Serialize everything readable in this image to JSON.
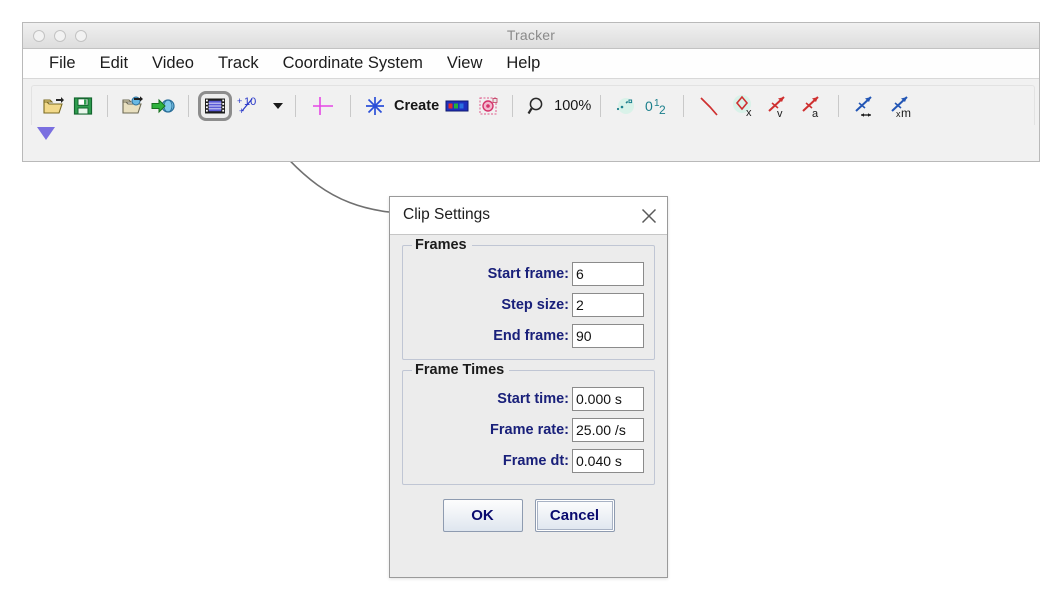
{
  "window": {
    "title": "Tracker",
    "traffic_lights": [
      "close-button",
      "minimize-button",
      "maximize-button"
    ]
  },
  "menubar": {
    "items": [
      {
        "label": "File",
        "name": "menu-file"
      },
      {
        "label": "Edit",
        "name": "menu-edit"
      },
      {
        "label": "Video",
        "name": "menu-video"
      },
      {
        "label": "Track",
        "name": "menu-track"
      },
      {
        "label": "Coordinate System",
        "name": "menu-coordinate-system"
      },
      {
        "label": "View",
        "name": "menu-view"
      },
      {
        "label": "Help",
        "name": "menu-help"
      }
    ]
  },
  "toolbar": {
    "create_label": "Create",
    "zoom_label": "100%",
    "buttons": [
      {
        "name": "open-file-button",
        "icon": "open-folder-icon"
      },
      {
        "name": "save-file-button",
        "icon": "floppy-save-icon"
      },
      {
        "name": "open-library-button",
        "icon": "open-folder-arrow-icon"
      },
      {
        "name": "library-browser-button",
        "icon": "green-arrow-globe-icon"
      },
      {
        "name": "clip-settings-button",
        "icon": "film-strip-icon",
        "selected": true
      },
      {
        "name": "frame-step-button",
        "icon": "plus-ten-icon"
      },
      {
        "name": "axes-button",
        "icon": "magenta-axes-icon"
      },
      {
        "name": "create-track-button",
        "icon": "blue-star-icon"
      },
      {
        "name": "track-control-button",
        "icon": "rgb-strip-icon"
      },
      {
        "name": "autotracker-button",
        "icon": "pink-target-icon"
      },
      {
        "name": "zoom-button",
        "icon": "magnifier-icon"
      },
      {
        "name": "trails-button",
        "icon": "teal-dots-icon"
      },
      {
        "name": "labels-button",
        "icon": "zero-one-two-icon"
      },
      {
        "name": "path-button",
        "icon": "red-path-icon"
      },
      {
        "name": "position-vector-button",
        "icon": "red-diamond-x-icon"
      },
      {
        "name": "velocity-vector-button",
        "icon": "red-arrow-v-icon"
      },
      {
        "name": "acceleration-vector-button",
        "icon": "red-arrow-a-icon"
      },
      {
        "name": "stretch-vector-button",
        "icon": "blue-arrow-stretch-icon"
      },
      {
        "name": "mass-vector-button",
        "icon": "blue-arrow-xm-icon"
      }
    ],
    "expand_arrow": "expand-triangle-icon"
  },
  "dialog": {
    "title": "Clip Settings",
    "close_icon": "close-x-icon",
    "groups": [
      {
        "title": "Frames",
        "name": "frames-group",
        "fields": [
          {
            "label": "Start frame:",
            "value": "6",
            "name": "start-frame"
          },
          {
            "label": "Step size:",
            "value": "2",
            "name": "step-size"
          },
          {
            "label": "End frame:",
            "value": "90",
            "name": "end-frame"
          }
        ]
      },
      {
        "title": "Frame Times",
        "name": "frame-times-group",
        "fields": [
          {
            "label": "Start time:",
            "value": "0.000 s",
            "name": "start-time"
          },
          {
            "label": "Frame rate:",
            "value": "25.00 /s",
            "name": "frame-rate"
          },
          {
            "label": "Frame dt:",
            "value": "0.040 s",
            "name": "frame-dt"
          }
        ]
      }
    ],
    "buttons": {
      "ok": "OK",
      "cancel": "Cancel"
    }
  },
  "colors": {
    "label_blue": "#19207a",
    "button_text": "#0a0a6e",
    "selection_border": "#8d8d8d",
    "callout_line": "#707070",
    "title_gray": "#8a8a8a"
  }
}
